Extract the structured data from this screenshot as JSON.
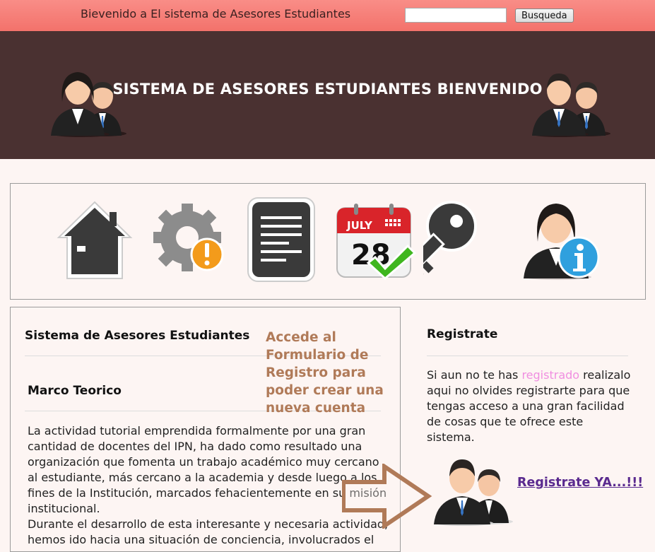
{
  "topbar": {
    "welcome": "Bievenido a El sistema de Asesores Estudiantes",
    "search_value": "",
    "search_button": "Busqueda"
  },
  "banner": {
    "title": "SISTEMA DE ASESORES ESTUDIANTES BIENVENIDO"
  },
  "iconbar": {
    "items": [
      {
        "icon": "home-icon"
      },
      {
        "icon": "settings-alert-icon"
      },
      {
        "icon": "document-icon"
      },
      {
        "icon": "calendar-icon",
        "month": "JULY",
        "day": "28"
      },
      {
        "icon": "key-icon"
      },
      {
        "icon": "user-info-icon"
      }
    ]
  },
  "left": {
    "heading1": "Sistema de Asesores Estudiantes",
    "heading2": "Marco Teorico",
    "callout": "Accede al Formulario de Registro para poder crear una nueva cuenta",
    "paragraph": "La actividad tutorial emprendida formalmente por una gran cantidad de docentes del IPN, ha dado como resultado una organización que fomenta un trabajo académico muy cercano al estudiante, más cercano a la academia y desde luego a los fines de la Institución, marcados fehacientemente en su misión institucional.",
    "paragraph2": "Durante el desarrollo de esta interesante y necesaria actividad, hemos ido hacia una situación de conciencia, involucrados el"
  },
  "right": {
    "heading": "Registrate",
    "text_before": "Si aun no te has ",
    "text_highlight": "registrado",
    "text_after": " realizalo aqui no olvides registrarte para que tengas acceso a una gran facilidad de cosas que te ofrece este sistema.",
    "register_link": "Registrate YA...!!!"
  },
  "colors": {
    "topbar": "#f3726b",
    "banner": "#4a3131",
    "callout": "#b07a58",
    "highlight": "#f08ee0",
    "link": "#5a2a8f"
  }
}
